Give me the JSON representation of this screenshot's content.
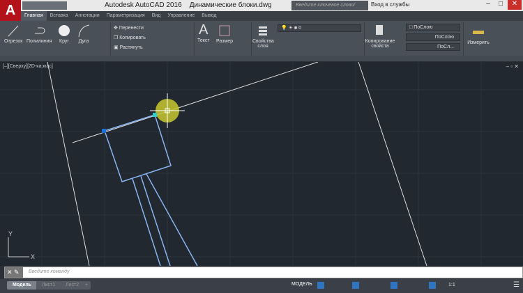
{
  "app": {
    "title": "Autodesk AutoCAD 2016",
    "filename": "Динамические блоки.dwg",
    "logo_letter": "A"
  },
  "search": {
    "placeholder": "Введите ключевое слово/фразу"
  },
  "signin": "Вход в службы",
  "tabs": [
    "Главная",
    "Вставка",
    "Аннотации",
    "Параметризация",
    "Вид",
    "Управление",
    "Вывод"
  ],
  "active_tab": "Главная",
  "ribbon": {
    "draw": [
      "Отрезок",
      "Полилиния",
      "Круг",
      "Дуга"
    ],
    "modify": [
      "Перенести",
      "Копировать",
      "Растянуть"
    ],
    "annotation": [
      "Текст",
      "Размер"
    ],
    "layers": {
      "label": "Свойства слоя",
      "current_layer": "0"
    },
    "properties": {
      "match": "Копирование свойств",
      "color": "ПоСлою",
      "linetype": "ПоСлою",
      "lineweight": "ПоСл..."
    },
    "measure": "Измерить"
  },
  "viewport": {
    "label": "[–][Сверху][2D-каркас]",
    "ucs_x": "X",
    "ucs_y": "Y"
  },
  "command": {
    "placeholder": "Введите команду"
  },
  "layout_tabs": [
    "Модель",
    "Лист1",
    "Лист2"
  ],
  "status": {
    "space": "МОДЕЛЬ",
    "scale": "1:1"
  },
  "colors": {
    "accent": "#b3121b",
    "grip": "#1e6fd9",
    "highlight": "#c8c830"
  }
}
